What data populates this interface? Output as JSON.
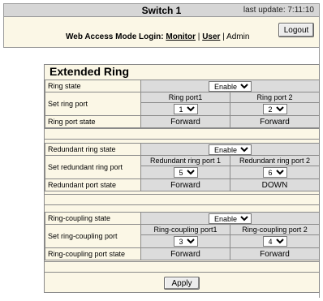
{
  "header": {
    "title": "Switch 1",
    "last_update": "last update: 7:11:10"
  },
  "login": {
    "prefix": "Web Access Mode Login:",
    "monitor": "Monitor",
    "sep1": "|",
    "user": "User",
    "sep2": "| Admin",
    "logout": "Logout"
  },
  "panel": {
    "title": "Extended Ring",
    "ring": {
      "state_label": "Ring state",
      "state_value": "Enable",
      "set_label": "Set ring port",
      "port1_header": "Ring port1",
      "port2_header": "Ring port 2",
      "port1_value": "1",
      "port2_value": "2",
      "port_state_label": "Ring port state",
      "port1_state": "Forward",
      "port2_state": "Forward"
    },
    "redundant": {
      "state_label": "Redundant ring state",
      "state_value": "Enable",
      "set_label": "Set redundant ring port",
      "port1_header": "Redundant ring port 1",
      "port2_header": "Redundant ring port 2",
      "port1_value": "5",
      "port2_value": "6",
      "port_state_label": "Redundant port state",
      "port1_state": "Forward",
      "port2_state": "DOWN"
    },
    "coupling": {
      "state_label": "Ring-coupling state",
      "state_value": "Enable",
      "set_label": "Set ring-coupling port",
      "port1_header": "Ring-coupling port1",
      "port2_header": "Ring-coupling port 2",
      "port1_value": "3",
      "port2_value": "4",
      "port_state_label": "Ring-coupling port state",
      "port1_state": "Forward",
      "port2_state": "Forward"
    },
    "apply": "Apply"
  }
}
